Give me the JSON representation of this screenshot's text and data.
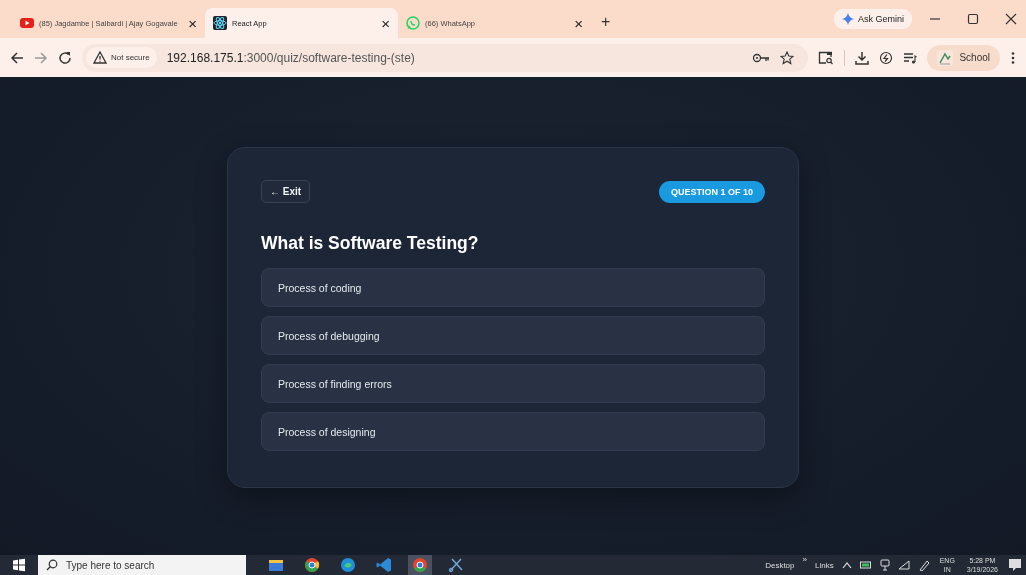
{
  "browser": {
    "tabs": [
      {
        "kind": "youtube",
        "title": "(85) Jagdambe | Salbardi | Ajay Gogavale",
        "selected": false
      },
      {
        "kind": "react",
        "title": "React App",
        "selected": true
      },
      {
        "kind": "whatsapp",
        "title": "(66) WhatsApp",
        "selected": false
      }
    ],
    "tab_close": "×",
    "new_tab": "+",
    "ask_gemini": "Ask Gemini",
    "security": "Not secure",
    "url_host": "192.168.175.1",
    "url_rest": ":3000/quiz/software-testing-(ste)",
    "profile": "School"
  },
  "quiz": {
    "exit": "← Exit",
    "progress": "QUESTION 1 OF 10",
    "question": "What is Software Testing?",
    "options": [
      {
        "text": "Process of coding",
        "selected": false
      },
      {
        "text": "Process of debugging",
        "selected": false
      },
      {
        "text": "Process of finding errors",
        "selected": false
      },
      {
        "text": "Process of designing",
        "selected": false
      }
    ]
  },
  "taskbar": {
    "search_placeholder": "Type here to search",
    "desktop": "Desktop",
    "chevron": "»",
    "links": "Links",
    "language": "ENG",
    "region": "IN",
    "time": "5:28 PM",
    "date": "3/19/2026"
  }
}
